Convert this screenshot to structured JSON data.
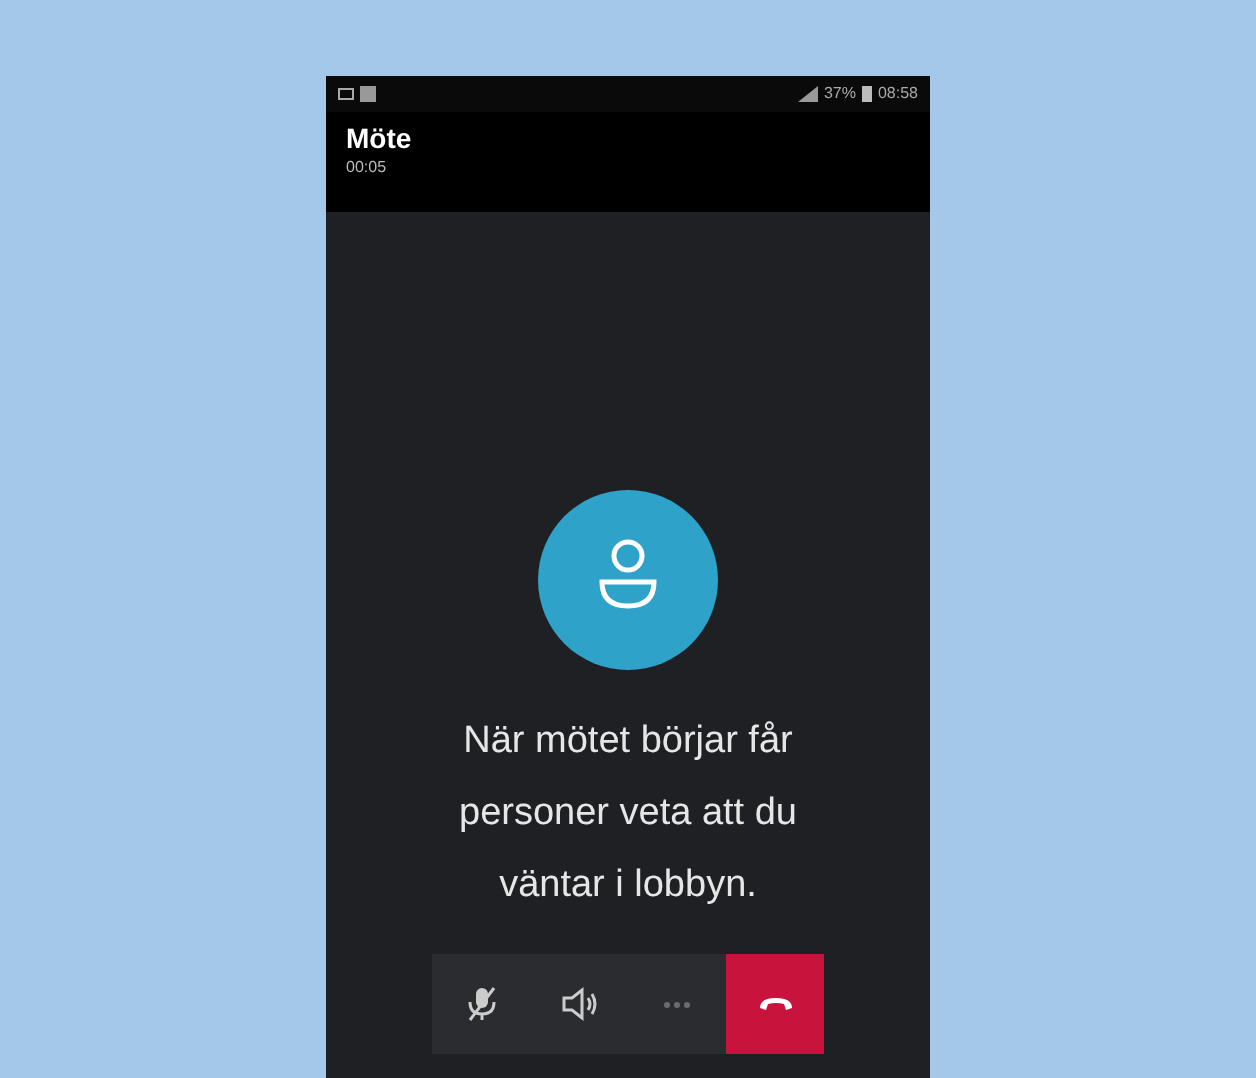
{
  "status_bar": {
    "battery": "37%",
    "time": "08:58"
  },
  "header": {
    "title": "Möte",
    "duration": "00:05"
  },
  "message": "När mötet börjar får personer veta att du väntar i lobbyn.",
  "controls": [
    {
      "kind": "mute",
      "disabled": false
    },
    {
      "kind": "speaker",
      "disabled": false
    },
    {
      "kind": "more",
      "disabled": true
    },
    {
      "kind": "hangup",
      "disabled": false
    }
  ]
}
